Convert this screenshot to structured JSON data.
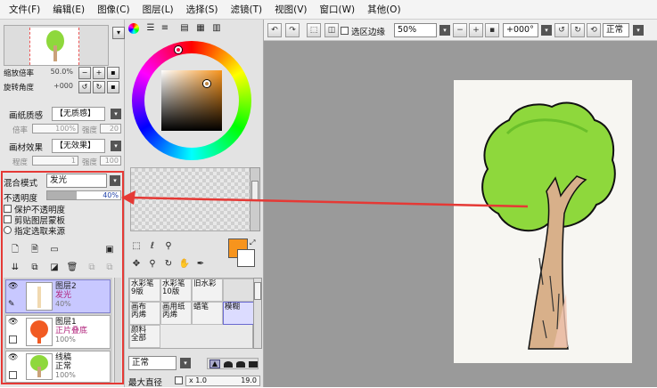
{
  "menu": [
    "文件(F)",
    "编辑(E)",
    "图像(C)",
    "图层(L)",
    "选择(S)",
    "滤镜(T)",
    "视图(V)",
    "窗口(W)",
    "其他(O)"
  ],
  "navigator": {
    "zoom_label": "缩放倍率",
    "zoom_value": "50.0%",
    "rotate_label": "旋转角度",
    "rotate_value": "+000"
  },
  "paper": {
    "texture_label": "画纸质感",
    "texture_value": "【无质感】",
    "scale_label": "倍率",
    "scale_value": "100%",
    "strength_label": "强度",
    "strength_value": "20",
    "effect_label": "画材效果",
    "effect_value": "【无效果】",
    "degree_label": "程度",
    "degree_value": "1",
    "strength2_label": "强度",
    "strength2_value": "100"
  },
  "layer_props": {
    "blend_label": "混合模式",
    "blend_value": "发光",
    "opacity_label": "不透明度",
    "opacity_value": "40%",
    "opacity_level": 0.4,
    "protect_label": "保护不透明度",
    "clip_label": "剪贴图层蒙板",
    "select_src_label": "指定选取来源"
  },
  "layers": [
    {
      "name": "图层2",
      "mode": "发光",
      "opacity": "40%",
      "selected": true
    },
    {
      "name": "图层1",
      "mode": "正片叠底",
      "opacity": "100%",
      "selected": false
    },
    {
      "name": "线稿",
      "mode": "正常",
      "opacity": "100%",
      "selected": false
    }
  ],
  "colors": {
    "primary": "#f7941d",
    "accent": "#e53935",
    "layer_select": "#c8c8ff"
  },
  "brushes": [
    {
      "label": "水彩笔",
      "sub": "9版",
      "selected": false
    },
    {
      "label": "水彩笔",
      "sub": "10版",
      "selected": false
    },
    {
      "label": "旧水彩",
      "sub": "",
      "selected": false
    },
    {
      "label": "画布",
      "sub": "丙烯",
      "selected": false
    },
    {
      "label": "画用纸",
      "sub": "丙烯",
      "selected": false
    },
    {
      "label": "蜡笔",
      "sub": "",
      "selected": false
    },
    {
      "label": "模糊",
      "sub": "",
      "selected": true
    },
    {
      "label": "颜料",
      "sub": "全部",
      "selected": false
    }
  ],
  "brush_settings": {
    "mode_value": "正常",
    "max_size_label": "最大直径",
    "max_size_mult": "x 1.0",
    "max_size_value": "19.0"
  },
  "toolbar": {
    "selection_edge_label": "选区边缘",
    "zoom_value": "50%",
    "rotate_value": "+000°",
    "mode_value": "正常"
  }
}
